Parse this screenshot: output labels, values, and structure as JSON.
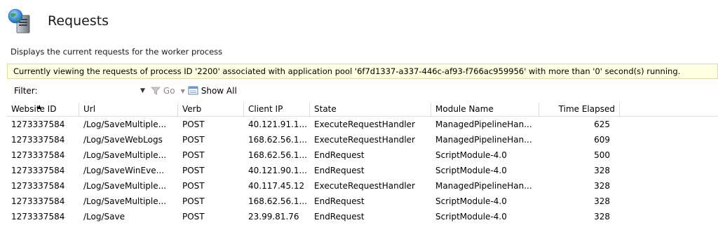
{
  "header": {
    "title": "Requests",
    "icon": "server-icon"
  },
  "description": "Displays the current requests for the worker process",
  "banner": "Currently viewing the requests of process ID '2200' associated with application pool '6f7d1337-a337-446c-af93-f766ac959956' with more than '0' second(s) running.",
  "toolbar": {
    "filter_label": "Filter:",
    "filter_value": "",
    "go_label": "Go",
    "show_all_label": "Show All"
  },
  "table": {
    "columns": [
      "Website ID",
      "Url",
      "Verb",
      "Client IP",
      "State",
      "Module Name",
      "Time Elapsed"
    ],
    "sorted_column": "Website ID",
    "rows": [
      [
        "1273337584",
        "/Log/SaveMultiple...",
        "POST",
        "40.121.91.1...",
        "ExecuteRequestHandler",
        "ManagedPipelineHan...",
        "625"
      ],
      [
        "1273337584",
        "/Log/SaveWebLogs",
        "POST",
        "168.62.56.1...",
        "ExecuteRequestHandler",
        "ManagedPipelineHan...",
        "609"
      ],
      [
        "1273337584",
        "/Log/SaveMultiple...",
        "POST",
        "168.62.56.1...",
        "EndRequest",
        "ScriptModule-4.0",
        "500"
      ],
      [
        "1273337584",
        "/Log/SaveWinEve...",
        "POST",
        "40.121.90.1...",
        "EndRequest",
        "ScriptModule-4.0",
        "328"
      ],
      [
        "1273337584",
        "/Log/SaveMultiple...",
        "POST",
        "40.117.45.12",
        "ExecuteRequestHandler",
        "ManagedPipelineHan...",
        "328"
      ],
      [
        "1273337584",
        "/Log/SaveMultiple...",
        "POST",
        "168.62.56.1...",
        "EndRequest",
        "ScriptModule-4.0",
        "328"
      ],
      [
        "1273337584",
        "/Log/Save",
        "POST",
        "23.99.81.76",
        "EndRequest",
        "ScriptModule-4.0",
        "328"
      ]
    ]
  }
}
